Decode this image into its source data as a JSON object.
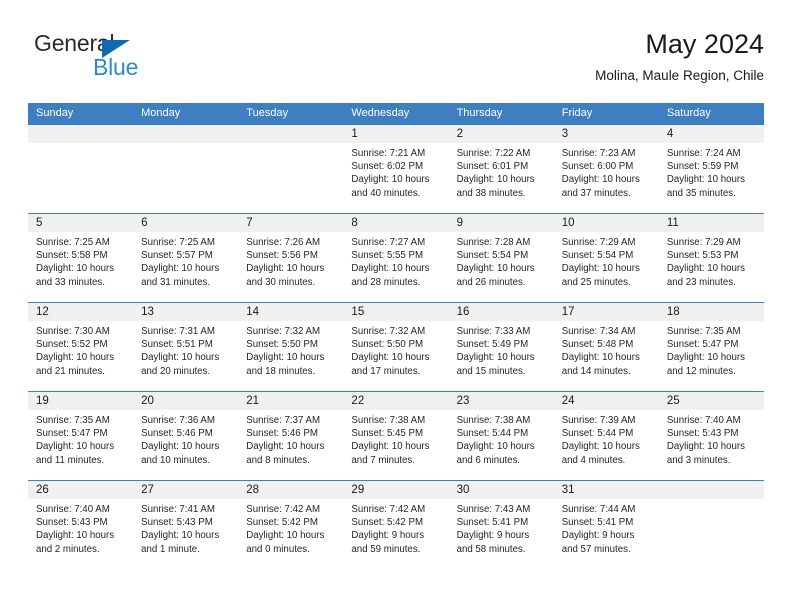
{
  "brand": {
    "name_part1": "General",
    "name_part2": "Blue",
    "accent_color": "#2a8ad4",
    "triangle_color": "#1268b3"
  },
  "header": {
    "title": "May 2024",
    "subtitle": "Molina, Maule Region, Chile"
  },
  "calendar": {
    "header_color": "#3d7fc1",
    "weekdays": [
      "Sunday",
      "Monday",
      "Tuesday",
      "Wednesday",
      "Thursday",
      "Friday",
      "Saturday"
    ],
    "weeks": [
      [
        {
          "day": "",
          "sunrise": "",
          "sunset": "",
          "daylight": "",
          "daylight2": ""
        },
        {
          "day": "",
          "sunrise": "",
          "sunset": "",
          "daylight": "",
          "daylight2": ""
        },
        {
          "day": "",
          "sunrise": "",
          "sunset": "",
          "daylight": "",
          "daylight2": ""
        },
        {
          "day": "1",
          "sunrise": "Sunrise: 7:21 AM",
          "sunset": "Sunset: 6:02 PM",
          "daylight": "Daylight: 10 hours",
          "daylight2": "and 40 minutes."
        },
        {
          "day": "2",
          "sunrise": "Sunrise: 7:22 AM",
          "sunset": "Sunset: 6:01 PM",
          "daylight": "Daylight: 10 hours",
          "daylight2": "and 38 minutes."
        },
        {
          "day": "3",
          "sunrise": "Sunrise: 7:23 AM",
          "sunset": "Sunset: 6:00 PM",
          "daylight": "Daylight: 10 hours",
          "daylight2": "and 37 minutes."
        },
        {
          "day": "4",
          "sunrise": "Sunrise: 7:24 AM",
          "sunset": "Sunset: 5:59 PM",
          "daylight": "Daylight: 10 hours",
          "daylight2": "and 35 minutes."
        }
      ],
      [
        {
          "day": "5",
          "sunrise": "Sunrise: 7:25 AM",
          "sunset": "Sunset: 5:58 PM",
          "daylight": "Daylight: 10 hours",
          "daylight2": "and 33 minutes."
        },
        {
          "day": "6",
          "sunrise": "Sunrise: 7:25 AM",
          "sunset": "Sunset: 5:57 PM",
          "daylight": "Daylight: 10 hours",
          "daylight2": "and 31 minutes."
        },
        {
          "day": "7",
          "sunrise": "Sunrise: 7:26 AM",
          "sunset": "Sunset: 5:56 PM",
          "daylight": "Daylight: 10 hours",
          "daylight2": "and 30 minutes."
        },
        {
          "day": "8",
          "sunrise": "Sunrise: 7:27 AM",
          "sunset": "Sunset: 5:55 PM",
          "daylight": "Daylight: 10 hours",
          "daylight2": "and 28 minutes."
        },
        {
          "day": "9",
          "sunrise": "Sunrise: 7:28 AM",
          "sunset": "Sunset: 5:54 PM",
          "daylight": "Daylight: 10 hours",
          "daylight2": "and 26 minutes."
        },
        {
          "day": "10",
          "sunrise": "Sunrise: 7:29 AM",
          "sunset": "Sunset: 5:54 PM",
          "daylight": "Daylight: 10 hours",
          "daylight2": "and 25 minutes."
        },
        {
          "day": "11",
          "sunrise": "Sunrise: 7:29 AM",
          "sunset": "Sunset: 5:53 PM",
          "daylight": "Daylight: 10 hours",
          "daylight2": "and 23 minutes."
        }
      ],
      [
        {
          "day": "12",
          "sunrise": "Sunrise: 7:30 AM",
          "sunset": "Sunset: 5:52 PM",
          "daylight": "Daylight: 10 hours",
          "daylight2": "and 21 minutes."
        },
        {
          "day": "13",
          "sunrise": "Sunrise: 7:31 AM",
          "sunset": "Sunset: 5:51 PM",
          "daylight": "Daylight: 10 hours",
          "daylight2": "and 20 minutes."
        },
        {
          "day": "14",
          "sunrise": "Sunrise: 7:32 AM",
          "sunset": "Sunset: 5:50 PM",
          "daylight": "Daylight: 10 hours",
          "daylight2": "and 18 minutes."
        },
        {
          "day": "15",
          "sunrise": "Sunrise: 7:32 AM",
          "sunset": "Sunset: 5:50 PM",
          "daylight": "Daylight: 10 hours",
          "daylight2": "and 17 minutes."
        },
        {
          "day": "16",
          "sunrise": "Sunrise: 7:33 AM",
          "sunset": "Sunset: 5:49 PM",
          "daylight": "Daylight: 10 hours",
          "daylight2": "and 15 minutes."
        },
        {
          "day": "17",
          "sunrise": "Sunrise: 7:34 AM",
          "sunset": "Sunset: 5:48 PM",
          "daylight": "Daylight: 10 hours",
          "daylight2": "and 14 minutes."
        },
        {
          "day": "18",
          "sunrise": "Sunrise: 7:35 AM",
          "sunset": "Sunset: 5:47 PM",
          "daylight": "Daylight: 10 hours",
          "daylight2": "and 12 minutes."
        }
      ],
      [
        {
          "day": "19",
          "sunrise": "Sunrise: 7:35 AM",
          "sunset": "Sunset: 5:47 PM",
          "daylight": "Daylight: 10 hours",
          "daylight2": "and 11 minutes."
        },
        {
          "day": "20",
          "sunrise": "Sunrise: 7:36 AM",
          "sunset": "Sunset: 5:46 PM",
          "daylight": "Daylight: 10 hours",
          "daylight2": "and 10 minutes."
        },
        {
          "day": "21",
          "sunrise": "Sunrise: 7:37 AM",
          "sunset": "Sunset: 5:46 PM",
          "daylight": "Daylight: 10 hours",
          "daylight2": "and 8 minutes."
        },
        {
          "day": "22",
          "sunrise": "Sunrise: 7:38 AM",
          "sunset": "Sunset: 5:45 PM",
          "daylight": "Daylight: 10 hours",
          "daylight2": "and 7 minutes."
        },
        {
          "day": "23",
          "sunrise": "Sunrise: 7:38 AM",
          "sunset": "Sunset: 5:44 PM",
          "daylight": "Daylight: 10 hours",
          "daylight2": "and 6 minutes."
        },
        {
          "day": "24",
          "sunrise": "Sunrise: 7:39 AM",
          "sunset": "Sunset: 5:44 PM",
          "daylight": "Daylight: 10 hours",
          "daylight2": "and 4 minutes."
        },
        {
          "day": "25",
          "sunrise": "Sunrise: 7:40 AM",
          "sunset": "Sunset: 5:43 PM",
          "daylight": "Daylight: 10 hours",
          "daylight2": "and 3 minutes."
        }
      ],
      [
        {
          "day": "26",
          "sunrise": "Sunrise: 7:40 AM",
          "sunset": "Sunset: 5:43 PM",
          "daylight": "Daylight: 10 hours",
          "daylight2": "and 2 minutes."
        },
        {
          "day": "27",
          "sunrise": "Sunrise: 7:41 AM",
          "sunset": "Sunset: 5:43 PM",
          "daylight": "Daylight: 10 hours",
          "daylight2": "and 1 minute."
        },
        {
          "day": "28",
          "sunrise": "Sunrise: 7:42 AM",
          "sunset": "Sunset: 5:42 PM",
          "daylight": "Daylight: 10 hours",
          "daylight2": "and 0 minutes."
        },
        {
          "day": "29",
          "sunrise": "Sunrise: 7:42 AM",
          "sunset": "Sunset: 5:42 PM",
          "daylight": "Daylight: 9 hours",
          "daylight2": "and 59 minutes."
        },
        {
          "day": "30",
          "sunrise": "Sunrise: 7:43 AM",
          "sunset": "Sunset: 5:41 PM",
          "daylight": "Daylight: 9 hours",
          "daylight2": "and 58 minutes."
        },
        {
          "day": "31",
          "sunrise": "Sunrise: 7:44 AM",
          "sunset": "Sunset: 5:41 PM",
          "daylight": "Daylight: 9 hours",
          "daylight2": "and 57 minutes."
        },
        {
          "day": "",
          "sunrise": "",
          "sunset": "",
          "daylight": "",
          "daylight2": ""
        }
      ]
    ]
  }
}
